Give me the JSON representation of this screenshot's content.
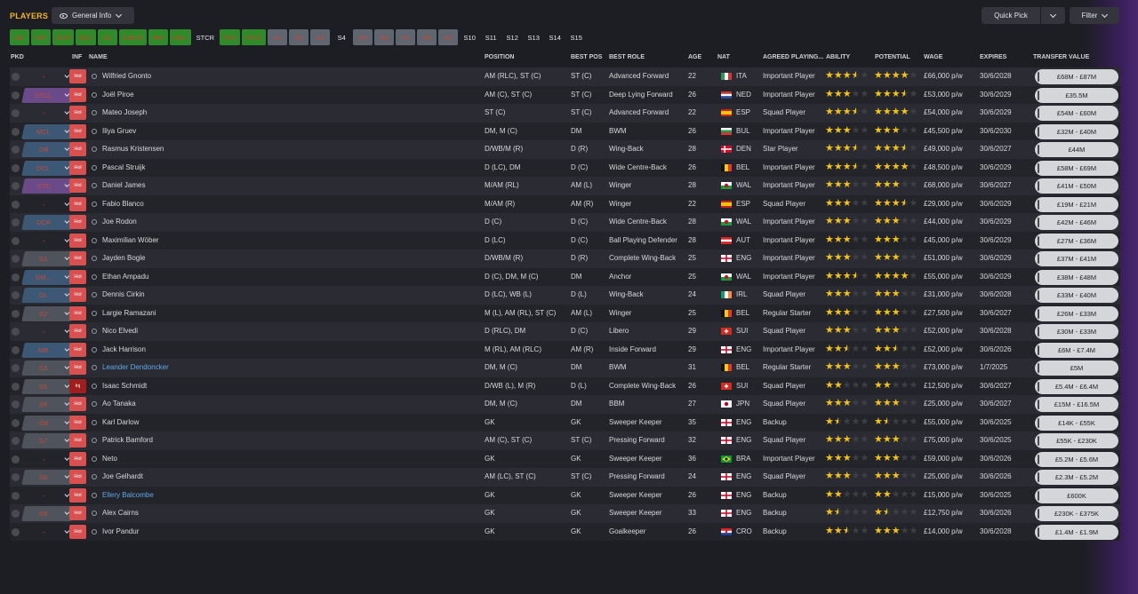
{
  "header": {
    "title": "PLAYERS",
    "view": "General Info",
    "quick_pick": "Quick Pick",
    "filter": "Filter"
  },
  "positions": [
    {
      "label": "GK",
      "style": "green"
    },
    {
      "label": "DR",
      "style": "green"
    },
    {
      "label": "DCR",
      "style": "green"
    },
    {
      "label": "DCL",
      "style": "green"
    },
    {
      "label": "DL",
      "style": "green"
    },
    {
      "label": "DMCR",
      "style": "green"
    },
    {
      "label": "MR",
      "style": "green"
    },
    {
      "label": "MCL",
      "style": "green"
    },
    {
      "label": "STCR",
      "style": "white"
    },
    {
      "label": "STC",
      "style": "green"
    },
    {
      "label": "STCL",
      "style": "green"
    },
    {
      "label": "S1",
      "style": "grey"
    },
    {
      "label": "S2",
      "style": "grey"
    },
    {
      "label": "S3",
      "style": "grey"
    },
    {
      "label": "S4",
      "style": "white"
    },
    {
      "label": "S5",
      "style": "grey"
    },
    {
      "label": "S6",
      "style": "grey"
    },
    {
      "label": "S7",
      "style": "grey"
    },
    {
      "label": "S8",
      "style": "grey"
    },
    {
      "label": "S9",
      "style": "grey"
    },
    {
      "label": "S10",
      "style": "white"
    },
    {
      "label": "S11",
      "style": "white"
    },
    {
      "label": "S12",
      "style": "white"
    },
    {
      "label": "S13",
      "style": "white"
    },
    {
      "label": "S14",
      "style": "white"
    },
    {
      "label": "S15",
      "style": "white"
    }
  ],
  "columns": {
    "pkd": "PKD",
    "inf": "INF",
    "name": "NAME",
    "position": "POSITION",
    "best_pos": "BEST POS",
    "best_role": "BEST ROLE",
    "age": "AGE",
    "nat": "NAT",
    "agreed": "AGREED PLAYING...",
    "ability": "ABILITY",
    "potential": "POTENTIAL",
    "wage": "WAGE",
    "expires": "EXPIRES",
    "value": "TRANSFER VALUE"
  },
  "players": [
    {
      "pkd": "-",
      "pkd_style": "none",
      "inf": "Hol",
      "name": "Wilfried Gnonto",
      "position": "AM (RLC), ST (C)",
      "best_pos": "ST (C)",
      "best_role": "Advanced Forward",
      "age": "22",
      "flag": "ITA",
      "nat": "ITA",
      "agreed": "Important Player",
      "ability": 3.5,
      "potential": 4,
      "wage": "£66,000 p/w",
      "expires": "30/6/2028",
      "value": "£68M - £87M"
    },
    {
      "pkd": "STCL",
      "pkd_style": "purple",
      "inf": "Hol",
      "name": "Joël Piroe",
      "position": "AM (C), ST (C)",
      "best_pos": "ST (C)",
      "best_role": "Deep Lying Forward",
      "age": "26",
      "flag": "NED",
      "nat": "NED",
      "agreed": "Important Player",
      "ability": 3,
      "potential": 3.5,
      "wage": "£53,000 p/w",
      "expires": "30/6/2029",
      "value": "£35.5M"
    },
    {
      "pkd": "-",
      "pkd_style": "none",
      "inf": "Hol",
      "name": "Mateo Joseph",
      "position": "ST (C)",
      "best_pos": "ST (C)",
      "best_role": "Advanced Forward",
      "age": "22",
      "flag": "ESP",
      "nat": "ESP",
      "agreed": "Squad Player",
      "ability": 3.5,
      "potential": 4,
      "wage": "£54,000 p/w",
      "expires": "30/6/2029",
      "value": "£54M - £60M"
    },
    {
      "pkd": "MCL",
      "pkd_style": "blue",
      "inf": "Hol",
      "name": "Iliya Gruev",
      "position": "DM, M (C)",
      "best_pos": "DM",
      "best_role": "BWM",
      "age": "26",
      "flag": "BUL",
      "nat": "BUL",
      "agreed": "Important Player",
      "ability": 3,
      "potential": 3,
      "wage": "£45,500 p/w",
      "expires": "30/6/2030",
      "value": "£32M - £40M"
    },
    {
      "pkd": "DR",
      "pkd_style": "blue",
      "inf": "Hol",
      "name": "Rasmus Kristensen",
      "position": "D/WB/M (R)",
      "best_pos": "D (R)",
      "best_role": "Wing-Back",
      "age": "28",
      "flag": "DEN",
      "nat": "DEN",
      "agreed": "Star Player",
      "ability": 3.5,
      "potential": 3.5,
      "wage": "£49,000 p/w",
      "expires": "30/6/2027",
      "value": "£44M"
    },
    {
      "pkd": "DCL",
      "pkd_style": "blue",
      "inf": "Hol",
      "name": "Pascal Struijk",
      "position": "D (LC), DM",
      "best_pos": "D (C)",
      "best_role": "Wide Centre-Back",
      "age": "26",
      "flag": "BEL",
      "nat": "BEL",
      "agreed": "Important Player",
      "ability": 3.5,
      "potential": 4,
      "wage": "£48,500 p/w",
      "expires": "30/6/2029",
      "value": "£58M - £69M"
    },
    {
      "pkd": "STC",
      "pkd_style": "purple",
      "inf": "Hol",
      "name": "Daniel James",
      "position": "M/AM (RL)",
      "best_pos": "AM (L)",
      "best_role": "Winger",
      "age": "28",
      "flag": "WAL",
      "nat": "WAL",
      "agreed": "Important Player",
      "ability": 3,
      "potential": 3,
      "wage": "£68,000 p/w",
      "expires": "30/6/2027",
      "value": "£41M - £50M"
    },
    {
      "pkd": "-",
      "pkd_style": "none",
      "inf": "Hol",
      "name": "Fabio Blanco",
      "position": "M/AM (R)",
      "best_pos": "AM (R)",
      "best_role": "Winger",
      "age": "22",
      "flag": "ESP",
      "nat": "ESP",
      "agreed": "Squad Player",
      "ability": 3,
      "potential": 3.5,
      "wage": "£29,000 p/w",
      "expires": "30/6/2029",
      "value": "£19M - £21M"
    },
    {
      "pkd": "DCR",
      "pkd_style": "blue",
      "inf": "Hol",
      "name": "Joe Rodon",
      "position": "D (C)",
      "best_pos": "D (C)",
      "best_role": "Wide Centre-Back",
      "age": "28",
      "flag": "WAL",
      "nat": "WAL",
      "agreed": "Important Player",
      "ability": 3,
      "potential": 3,
      "wage": "£44,000 p/w",
      "expires": "30/6/2029",
      "value": "£42M - £46M"
    },
    {
      "pkd": "-",
      "pkd_style": "none",
      "inf": "Hol",
      "name": "Maximilian Wöber",
      "position": "D (LC)",
      "best_pos": "D (C)",
      "best_role": "Ball Playing Defender",
      "age": "28",
      "flag": "AUT",
      "nat": "AUT",
      "agreed": "Important Player",
      "ability": 3,
      "potential": 3,
      "wage": "£45,000 p/w",
      "expires": "30/6/2029",
      "value": "£27M - £36M"
    },
    {
      "pkd": "S1",
      "pkd_style": "grey",
      "inf": "Hol",
      "name": "Jayden Bogle",
      "position": "D/WB/M (R)",
      "best_pos": "D (R)",
      "best_role": "Complete Wing-Back",
      "age": "25",
      "flag": "ENG",
      "nat": "ENG",
      "agreed": "Important Player",
      "ability": 3,
      "potential": 3,
      "wage": "£51,000 p/w",
      "expires": "30/6/2029",
      "value": "£37M - £41M"
    },
    {
      "pkd": "DM...",
      "pkd_style": "blue",
      "inf": "Hol",
      "name": "Ethan Ampadu",
      "position": "D (C), DM, M (C)",
      "best_pos": "DM",
      "best_role": "Anchor",
      "age": "25",
      "flag": "WAL",
      "nat": "WAL",
      "agreed": "Important Player",
      "ability": 3.5,
      "potential": 4,
      "wage": "£55,000 p/w",
      "expires": "30/6/2029",
      "value": "£38M - £48M"
    },
    {
      "pkd": "DL",
      "pkd_style": "blue",
      "inf": "Hol",
      "name": "Dennis Cirkin",
      "position": "D (LC), WB (L)",
      "best_pos": "D (L)",
      "best_role": "Wing-Back",
      "age": "24",
      "flag": "IRL",
      "nat": "IRL",
      "agreed": "Squad Player",
      "ability": 3,
      "potential": 3,
      "wage": "£31,000 p/w",
      "expires": "30/6/2028",
      "value": "£33M - £40M"
    },
    {
      "pkd": "S2",
      "pkd_style": "grey",
      "inf": "Hol",
      "name": "Largie Ramazani",
      "position": "M (L), AM (RL), ST (C)",
      "best_pos": "AM (L)",
      "best_role": "Winger",
      "age": "25",
      "flag": "BEL",
      "nat": "BEL",
      "agreed": "Regular Starter",
      "ability": 3,
      "potential": 3,
      "wage": "£27,500 p/w",
      "expires": "30/6/2027",
      "value": "£26M - £33M"
    },
    {
      "pkd": "-",
      "pkd_style": "none",
      "inf": "Hol",
      "name": "Nico Elvedi",
      "position": "D (RLC), DM",
      "best_pos": "D (C)",
      "best_role": "Libero",
      "age": "29",
      "flag": "SUI",
      "nat": "SUI",
      "agreed": "Squad Player",
      "ability": 3,
      "potential": 3,
      "wage": "£52,000 p/w",
      "expires": "30/6/2028",
      "value": "£30M - £33M"
    },
    {
      "pkd": "MR",
      "pkd_style": "blue",
      "inf": "Hol",
      "name": "Jack Harrison",
      "position": "M (RL), AM (RLC)",
      "best_pos": "AM (R)",
      "best_role": "Inside Forward",
      "age": "29",
      "flag": "ENG",
      "nat": "ENG",
      "agreed": "Important Player",
      "ability": 2.5,
      "potential": 2.5,
      "wage": "£52,000 p/w",
      "expires": "30/6/2026",
      "value": "£6M - £7.4M"
    },
    {
      "pkd": "S3",
      "pkd_style": "grey",
      "inf": "Hol",
      "name": "Leander Dendoncker",
      "loan": true,
      "position": "DM, M (C)",
      "best_pos": "DM",
      "best_role": "BWM",
      "age": "31",
      "flag": "BEL",
      "nat": "BEL",
      "agreed": "Regular Starter",
      "ability": 3,
      "potential": 3,
      "wage": "£73,000 p/w",
      "expires": "1/7/2025",
      "value": "£5M"
    },
    {
      "pkd": "S5",
      "pkd_style": "grey",
      "inf": "Inj",
      "name": "Isaac Schmidt",
      "position": "D/WB (L), M (R)",
      "best_pos": "D (L)",
      "best_role": "Complete Wing-Back",
      "age": "26",
      "flag": "SUI",
      "nat": "SUI",
      "agreed": "Squad Player",
      "ability": 2,
      "potential": 2,
      "wage": "£12,500 p/w",
      "expires": "30/6/2027",
      "value": "£5.4M - £6.4M"
    },
    {
      "pkd": "S6",
      "pkd_style": "grey",
      "inf": "Hol",
      "name": "Ao Tanaka",
      "position": "DM, M (C)",
      "best_pos": "DM",
      "best_role": "BBM",
      "age": "27",
      "flag": "JPN",
      "nat": "JPN",
      "agreed": "Squad Player",
      "ability": 3,
      "potential": 3,
      "wage": "£25,000 p/w",
      "expires": "30/6/2027",
      "value": "£15M - £16.5M"
    },
    {
      "pkd": "GK",
      "pkd_style": "grey",
      "inf": "Hol",
      "name": "Karl Darlow",
      "position": "GK",
      "best_pos": "GK",
      "best_role": "Sweeper Keeper",
      "age": "35",
      "flag": "ENG",
      "nat": "ENG",
      "agreed": "Backup",
      "ability": 1.5,
      "potential": 1.5,
      "wage": "£55,000 p/w",
      "expires": "30/6/2025",
      "value": "£14K - £55K"
    },
    {
      "pkd": "S7",
      "pkd_style": "grey",
      "inf": "Hol",
      "name": "Patrick Bamford",
      "position": "AM (C), ST (C)",
      "best_pos": "ST (C)",
      "best_role": "Pressing Forward",
      "age": "32",
      "flag": "ENG",
      "nat": "ENG",
      "agreed": "Squad Player",
      "ability": 3,
      "potential": 3,
      "wage": "£75,000 p/w",
      "expires": "30/6/2025",
      "value": "£55K - £230K"
    },
    {
      "pkd": "-",
      "pkd_style": "none",
      "inf": "Hol",
      "name": "Neto",
      "position": "GK",
      "best_pos": "GK",
      "best_role": "Sweeper Keeper",
      "age": "36",
      "flag": "BRA",
      "nat": "BRA",
      "agreed": "Important Player",
      "ability": 3,
      "potential": 3,
      "wage": "£59,000 p/w",
      "expires": "30/6/2026",
      "value": "£5.2M - £5.6M"
    },
    {
      "pkd": "S8",
      "pkd_style": "grey",
      "inf": "Hol",
      "name": "Joe Gelhardt",
      "position": "AM (LC), ST (C)",
      "best_pos": "ST (C)",
      "best_role": "Pressing Forward",
      "age": "24",
      "flag": "ENG",
      "nat": "ENG",
      "agreed": "Squad Player",
      "ability": 3,
      "potential": 3,
      "wage": "£25,000 p/w",
      "expires": "30/6/2026",
      "value": "£2.3M - £5.2M"
    },
    {
      "pkd": "-",
      "pkd_style": "none",
      "inf": "Hol",
      "name": "Ellery Balcombe",
      "loan": true,
      "position": "GK",
      "best_pos": "GK",
      "best_role": "Sweeper Keeper",
      "age": "26",
      "flag": "ENG",
      "nat": "ENG",
      "agreed": "Backup",
      "ability": 2,
      "potential": 2,
      "wage": "£15,000 p/w",
      "expires": "30/6/2025",
      "value": "£600K"
    },
    {
      "pkd": "S9",
      "pkd_style": "grey",
      "inf": "Hol",
      "name": "Alex Cairns",
      "position": "GK",
      "best_pos": "GK",
      "best_role": "Sweeper Keeper",
      "age": "33",
      "flag": "ENG",
      "nat": "ENG",
      "agreed": "Backup",
      "ability": 1.5,
      "potential": 1.5,
      "wage": "£12,750 p/w",
      "expires": "30/6/2026",
      "value": "£230K - £375K"
    },
    {
      "pkd": "-",
      "pkd_style": "none",
      "inf": "Hol",
      "name": "Ivor Pandur",
      "position": "GK",
      "best_pos": "GK",
      "best_role": "Goalkeeper",
      "age": "26",
      "flag": "CRO",
      "nat": "CRO",
      "agreed": "Backup",
      "ability": 2.5,
      "potential": 3,
      "wage": "£14,000 p/w",
      "expires": "30/6/2028",
      "value": "£1.4M - £1.9M"
    }
  ]
}
